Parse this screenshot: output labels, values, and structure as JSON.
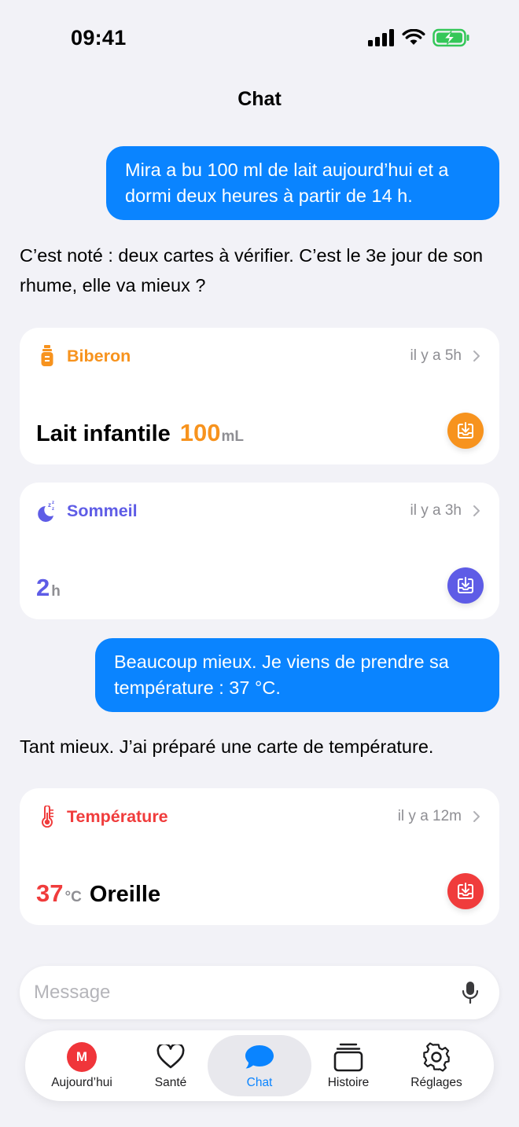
{
  "status": {
    "time": "09:41"
  },
  "nav": {
    "title": "Chat"
  },
  "messages": {
    "user_1": "Mira a bu 100 ml de lait aujourd’hui et a dormi deux heures à partir de 14 h.",
    "assistant_1": "C’est noté : deux cartes à vérifier. C’est le 3e jour de son rhume, elle va mieux ?",
    "user_2": "Beaucoup mieux. Je viens de prendre sa température : 37 °C.",
    "assistant_2": "Tant mieux. J’ai préparé une carte de température."
  },
  "cards": {
    "bottle": {
      "title": "Biberon",
      "time": "il y a 5h",
      "label": "Lait infantile",
      "value": "100",
      "unit": "mL",
      "color": "#f7931e",
      "icon": "bottle-icon"
    },
    "sleep": {
      "title": "Sommeil",
      "time": "il y a 3h",
      "value": "2",
      "unit": "h",
      "color": "#5e5ce6",
      "icon": "moon-zzz-icon"
    },
    "temperature": {
      "title": "Température",
      "time": "il y a 12m",
      "value": "37",
      "unit": "°C",
      "label": "Oreille",
      "color": "#f03c3c",
      "icon": "thermometer-icon"
    }
  },
  "composer": {
    "placeholder": "Message",
    "icon": "microphone-icon"
  },
  "tabs": [
    {
      "label": "Aujourd’hui",
      "avatar": "M",
      "icon": "avatar"
    },
    {
      "label": "Santé",
      "icon": "heart-icon"
    },
    {
      "label": "Chat",
      "icon": "chat-bubble-icon",
      "active": true
    },
    {
      "label": "Histoire",
      "icon": "stack-icon"
    },
    {
      "label": "Réglages",
      "icon": "gear-icon"
    }
  ],
  "colors": {
    "accent": "#0a84ff",
    "background": "#f2f2f7"
  }
}
